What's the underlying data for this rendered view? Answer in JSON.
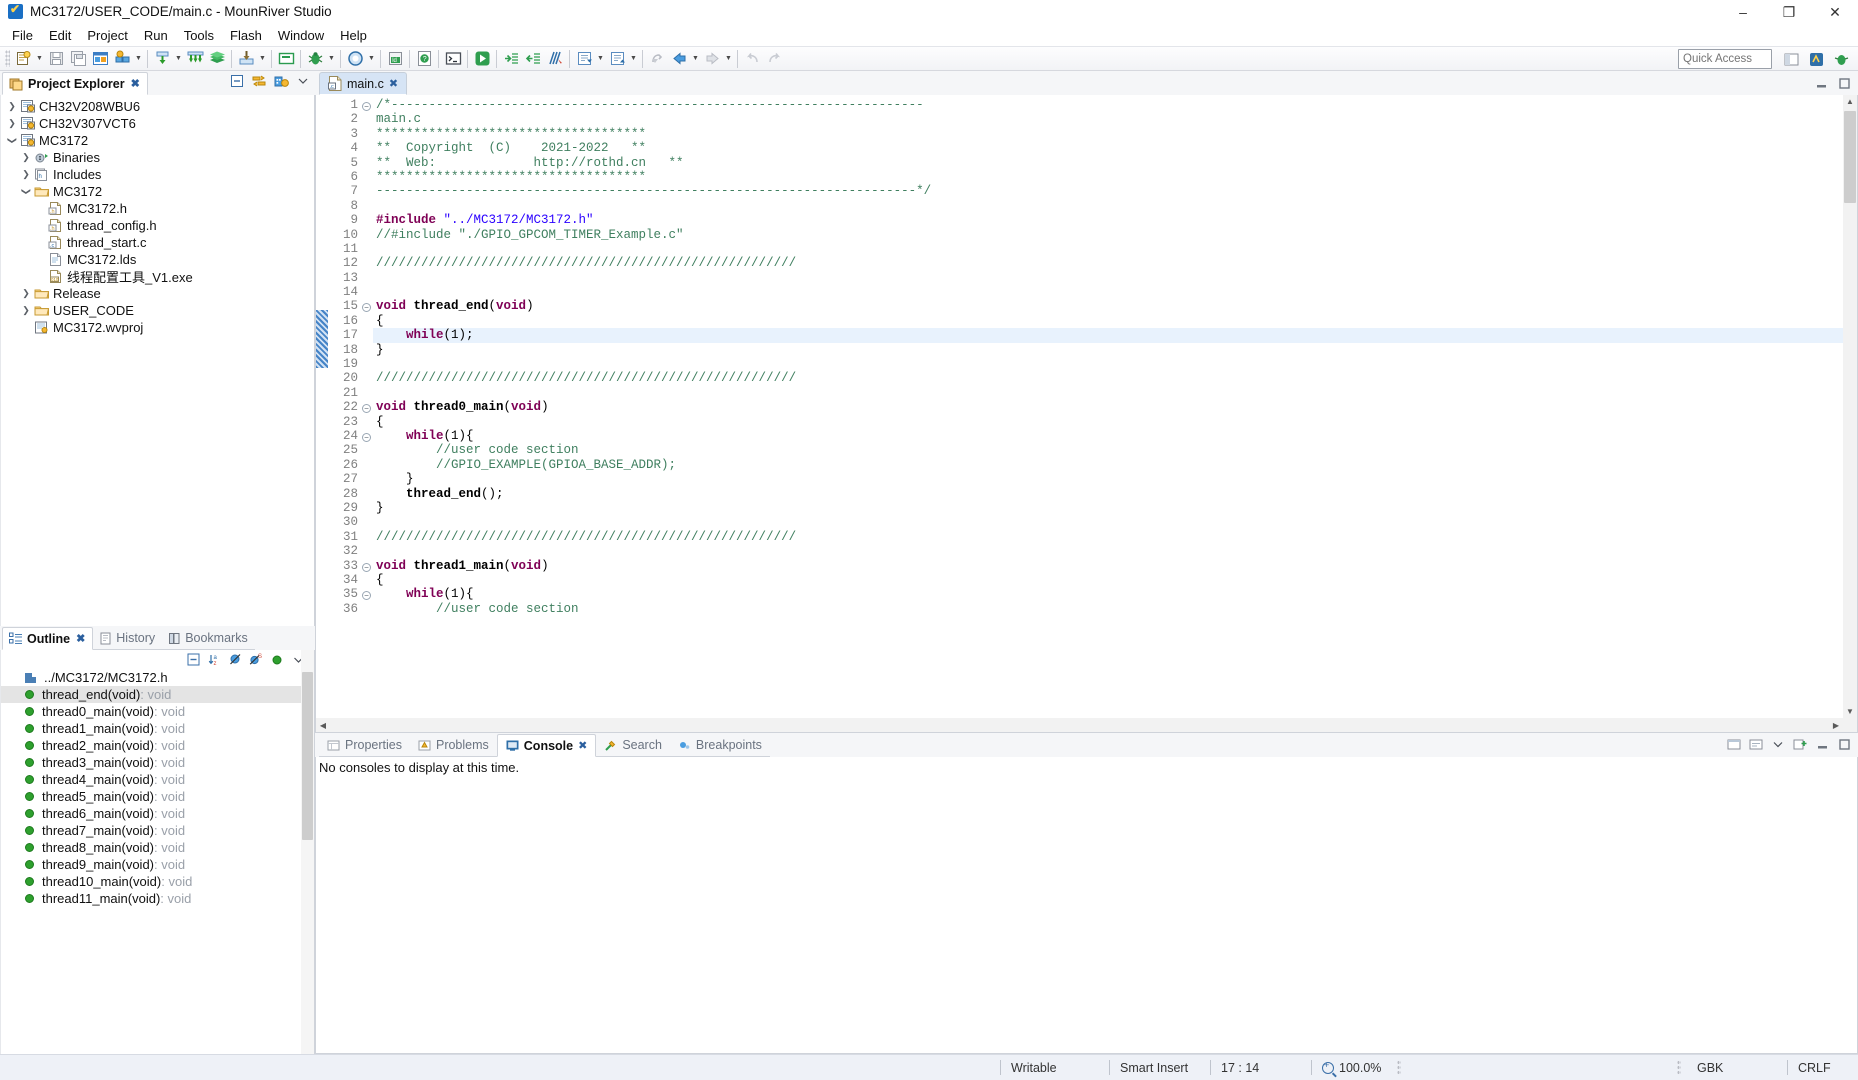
{
  "window": {
    "title": "MC3172/USER_CODE/main.c - MounRiver Studio",
    "app_icon": "mounriver-logo-icon",
    "minimize": "–",
    "maximize": "❐",
    "close": "✕"
  },
  "menubar": {
    "items": [
      {
        "label": "File"
      },
      {
        "label": "Edit"
      },
      {
        "label": "Project"
      },
      {
        "label": "Run"
      },
      {
        "label": "Tools"
      },
      {
        "label": "Flash"
      },
      {
        "label": "Window"
      },
      {
        "label": "Help"
      }
    ]
  },
  "toolbar": {
    "quick_access_placeholder": "Quick Access",
    "buttons": [
      "new-file-icon",
      "save-icon",
      "save-all-icon",
      "new-project-icon",
      "build-config-icon",
      "build-icon",
      "build-all-icon",
      "clean-icon",
      "download-icon",
      "terminal-icon",
      "debug-icon",
      "run-icon",
      "indent-icon",
      "outdent-icon",
      "compare-icon",
      "next-annotation-icon",
      "previous-annotation-icon",
      "back-icon",
      "forward-icon",
      "undo-icon",
      "redo-icon"
    ]
  },
  "project_explorer": {
    "tab_label": "Project Explorer",
    "tab_icon": "project-explorer-icon",
    "close_icon": "✖",
    "tools": [
      "collapse-all-icon",
      "link-with-editor-icon",
      "build-project-icon",
      "view-menu-icon"
    ],
    "tree": [
      {
        "label": "CH32V208WBU6",
        "indent": 0,
        "twist": "collapsed",
        "icon": "c-project-icon"
      },
      {
        "label": "CH32V307VCT6",
        "indent": 0,
        "twist": "collapsed",
        "icon": "c-project-icon"
      },
      {
        "label": "MC3172",
        "indent": 0,
        "twist": "expanded",
        "icon": "c-project-icon"
      },
      {
        "label": "Binaries",
        "indent": 1,
        "twist": "collapsed",
        "icon": "binaries-icon"
      },
      {
        "label": "Includes",
        "indent": 1,
        "twist": "collapsed",
        "icon": "includes-icon"
      },
      {
        "label": "MC3172",
        "indent": 1,
        "twist": "expanded",
        "icon": "folder-icon"
      },
      {
        "label": "MC3172.h",
        "indent": 2,
        "twist": "none",
        "icon": "h-file-icon"
      },
      {
        "label": "thread_config.h",
        "indent": 2,
        "twist": "none",
        "icon": "h-file-icon"
      },
      {
        "label": "thread_start.c",
        "indent": 2,
        "twist": "none",
        "icon": "c-file-icon"
      },
      {
        "label": "MC3172.lds",
        "indent": 2,
        "twist": "none",
        "icon": "text-file-icon"
      },
      {
        "label": "线程配置工具_V1.exe",
        "indent": 2,
        "twist": "none",
        "icon": "exe-file-icon"
      },
      {
        "label": "Release",
        "indent": 1,
        "twist": "collapsed",
        "icon": "folder-icon"
      },
      {
        "label": "USER_CODE",
        "indent": 1,
        "twist": "collapsed",
        "icon": "folder-icon"
      },
      {
        "label": "MC3172.wvproj",
        "indent": 1,
        "twist": "none",
        "icon": "project-file-icon"
      }
    ]
  },
  "outline": {
    "tabs": [
      {
        "label": "Outline",
        "icon": "outline-icon",
        "active": true,
        "close_icon": "✖"
      },
      {
        "label": "History",
        "icon": "history-icon",
        "active": false
      },
      {
        "label": "Bookmarks",
        "icon": "bookmarks-icon",
        "active": false
      }
    ],
    "tools": [
      "collapse-all-icon",
      "sort-icon",
      "hide-fields-icon",
      "hide-static-icon",
      "hide-nonpublic-icon",
      "view-menu-icon"
    ],
    "items": [
      {
        "name": "../MC3172/MC3172.h",
        "type": "",
        "kind": "include",
        "selected": false
      },
      {
        "name": "thread_end(void)",
        "type": " : void",
        "kind": "function",
        "selected": true
      },
      {
        "name": "thread0_main(void)",
        "type": " : void",
        "kind": "function",
        "selected": false
      },
      {
        "name": "thread1_main(void)",
        "type": " : void",
        "kind": "function",
        "selected": false
      },
      {
        "name": "thread2_main(void)",
        "type": " : void",
        "kind": "function",
        "selected": false
      },
      {
        "name": "thread3_main(void)",
        "type": " : void",
        "kind": "function",
        "selected": false
      },
      {
        "name": "thread4_main(void)",
        "type": " : void",
        "kind": "function",
        "selected": false
      },
      {
        "name": "thread5_main(void)",
        "type": " : void",
        "kind": "function",
        "selected": false
      },
      {
        "name": "thread6_main(void)",
        "type": " : void",
        "kind": "function",
        "selected": false
      },
      {
        "name": "thread7_main(void)",
        "type": " : void",
        "kind": "function",
        "selected": false
      },
      {
        "name": "thread8_main(void)",
        "type": " : void",
        "kind": "function",
        "selected": false
      },
      {
        "name": "thread9_main(void)",
        "type": " : void",
        "kind": "function",
        "selected": false
      },
      {
        "name": "thread10_main(void)",
        "type": " : void",
        "kind": "function",
        "selected": false
      },
      {
        "name": "thread11_main(void)",
        "type": " : void",
        "kind": "function",
        "selected": false
      }
    ]
  },
  "editor": {
    "tab": {
      "label": "main.c",
      "icon": "c-file-icon",
      "close_icon": "✖"
    },
    "tools": [
      "minimize-icon",
      "maximize-icon"
    ],
    "first_line": 1,
    "lines": [
      {
        "n": 1,
        "fold": "open",
        "tokens": [
          {
            "t": "cmt",
            "v": "/*-----------------------------------------------------------------------"
          }
        ]
      },
      {
        "n": 2,
        "fold": "",
        "tokens": [
          {
            "t": "cmt",
            "v": "main.c"
          }
        ]
      },
      {
        "n": 3,
        "fold": "",
        "tokens": [
          {
            "t": "cmt",
            "v": "************************************"
          }
        ]
      },
      {
        "n": 4,
        "fold": "",
        "tokens": [
          {
            "t": "cmt",
            "v": "**  Copyright  (C)    2021-2022   **"
          }
        ]
      },
      {
        "n": 5,
        "fold": "",
        "tokens": [
          {
            "t": "cmt",
            "v": "**  Web:             http://rothd.cn   **"
          }
        ]
      },
      {
        "n": 6,
        "fold": "",
        "tokens": [
          {
            "t": "cmt",
            "v": "************************************"
          }
        ]
      },
      {
        "n": 7,
        "fold": "",
        "tokens": [
          {
            "t": "cmt",
            "v": "------------------------------------------------------------------------*/"
          }
        ]
      },
      {
        "n": 8,
        "fold": "",
        "tokens": []
      },
      {
        "n": 9,
        "fold": "",
        "tokens": [
          {
            "t": "pre",
            "v": "#include "
          },
          {
            "t": "str",
            "v": "\"../MC3172/MC3172.h\""
          }
        ]
      },
      {
        "n": 10,
        "fold": "",
        "tokens": [
          {
            "t": "cmt",
            "v": "//#include \"./GPIO_GPCOM_TIMER_Example.c\""
          }
        ]
      },
      {
        "n": 11,
        "fold": "",
        "tokens": []
      },
      {
        "n": 12,
        "fold": "",
        "tokens": [
          {
            "t": "cmt",
            "v": "////////////////////////////////////////////////////////"
          }
        ]
      },
      {
        "n": 13,
        "fold": "",
        "tokens": []
      },
      {
        "n": 14,
        "fold": "",
        "tokens": []
      },
      {
        "n": 15,
        "fold": "open",
        "change": true,
        "tokens": [
          {
            "t": "kw",
            "v": "void "
          },
          {
            "t": "fn",
            "v": "thread_end"
          },
          {
            "t": "txt",
            "v": "("
          },
          {
            "t": "kw",
            "v": "void"
          },
          {
            "t": "txt",
            "v": ")"
          }
        ]
      },
      {
        "n": 16,
        "fold": "",
        "change": true,
        "tokens": [
          {
            "t": "txt",
            "v": "{"
          }
        ]
      },
      {
        "n": 17,
        "fold": "",
        "change": true,
        "highlight": true,
        "tokens": [
          {
            "t": "txt",
            "v": "    "
          },
          {
            "t": "kw",
            "v": "while"
          },
          {
            "t": "txt",
            "v": "(1);"
          }
        ]
      },
      {
        "n": 18,
        "fold": "",
        "change": true,
        "tokens": [
          {
            "t": "txt",
            "v": "}"
          }
        ]
      },
      {
        "n": 19,
        "fold": "",
        "tokens": []
      },
      {
        "n": 20,
        "fold": "",
        "tokens": [
          {
            "t": "cmt",
            "v": "////////////////////////////////////////////////////////"
          }
        ]
      },
      {
        "n": 21,
        "fold": "",
        "tokens": []
      },
      {
        "n": 22,
        "fold": "open",
        "tokens": [
          {
            "t": "kw",
            "v": "void "
          },
          {
            "t": "fn",
            "v": "thread0_main"
          },
          {
            "t": "txt",
            "v": "("
          },
          {
            "t": "kw",
            "v": "void"
          },
          {
            "t": "txt",
            "v": ")"
          }
        ]
      },
      {
        "n": 23,
        "fold": "",
        "tokens": [
          {
            "t": "txt",
            "v": "{"
          }
        ]
      },
      {
        "n": 24,
        "fold": "open",
        "tokens": [
          {
            "t": "txt",
            "v": "    "
          },
          {
            "t": "kw",
            "v": "while"
          },
          {
            "t": "txt",
            "v": "(1){"
          }
        ]
      },
      {
        "n": 25,
        "fold": "",
        "tokens": [
          {
            "t": "txt",
            "v": "        "
          },
          {
            "t": "cmt",
            "v": "//user code section"
          }
        ]
      },
      {
        "n": 26,
        "fold": "",
        "tokens": [
          {
            "t": "txt",
            "v": "        "
          },
          {
            "t": "cmt",
            "v": "//GPIO_EXAMPLE(GPIOA_BASE_ADDR);"
          }
        ]
      },
      {
        "n": 27,
        "fold": "",
        "tokens": [
          {
            "t": "txt",
            "v": "    }"
          }
        ]
      },
      {
        "n": 28,
        "fold": "",
        "tokens": [
          {
            "t": "txt",
            "v": "    "
          },
          {
            "t": "fn",
            "v": "thread_end"
          },
          {
            "t": "txt",
            "v": "();"
          }
        ]
      },
      {
        "n": 29,
        "fold": "",
        "tokens": [
          {
            "t": "txt",
            "v": "}"
          }
        ]
      },
      {
        "n": 30,
        "fold": "",
        "tokens": []
      },
      {
        "n": 31,
        "fold": "",
        "tokens": [
          {
            "t": "cmt",
            "v": "////////////////////////////////////////////////////////"
          }
        ]
      },
      {
        "n": 32,
        "fold": "",
        "tokens": []
      },
      {
        "n": 33,
        "fold": "open",
        "tokens": [
          {
            "t": "kw",
            "v": "void "
          },
          {
            "t": "fn",
            "v": "thread1_main"
          },
          {
            "t": "txt",
            "v": "("
          },
          {
            "t": "kw",
            "v": "void"
          },
          {
            "t": "txt",
            "v": ")"
          }
        ]
      },
      {
        "n": 34,
        "fold": "",
        "tokens": [
          {
            "t": "txt",
            "v": "{"
          }
        ]
      },
      {
        "n": 35,
        "fold": "open",
        "tokens": [
          {
            "t": "txt",
            "v": "    "
          },
          {
            "t": "kw",
            "v": "while"
          },
          {
            "t": "txt",
            "v": "(1){"
          }
        ]
      },
      {
        "n": 36,
        "fold": "",
        "tokens": [
          {
            "t": "txt",
            "v": "        "
          },
          {
            "t": "cmt",
            "v": "//user code section"
          }
        ]
      }
    ]
  },
  "console": {
    "tabs": [
      {
        "label": "Properties",
        "icon": "properties-icon",
        "active": false
      },
      {
        "label": "Problems",
        "icon": "problems-icon",
        "active": false
      },
      {
        "label": "Console",
        "icon": "console-icon",
        "active": true,
        "close_icon": "✖"
      },
      {
        "label": "Search",
        "icon": "search-icon",
        "active": false
      },
      {
        "label": "Breakpoints",
        "icon": "breakpoints-icon",
        "active": false
      }
    ],
    "tools": [
      "open-console-icon",
      "display-selected-console-icon",
      "new-console-view-icon",
      "minimize-icon",
      "maximize-icon"
    ],
    "message": "No consoles to display at this time."
  },
  "statusbar": {
    "writable": "Writable",
    "insert_mode": "Smart Insert",
    "cursor_position": "17 : 14",
    "zoom": "100.0%",
    "encoding": "GBK",
    "line_ending": "CRLF"
  },
  "colors": {
    "accent": "#2e6fb7",
    "comment": "#3f7f5f",
    "keyword": "#7f0055",
    "string": "#2a00ff",
    "highlight_line": "#e8f2fd",
    "tab_active": "#d6e4f5"
  }
}
